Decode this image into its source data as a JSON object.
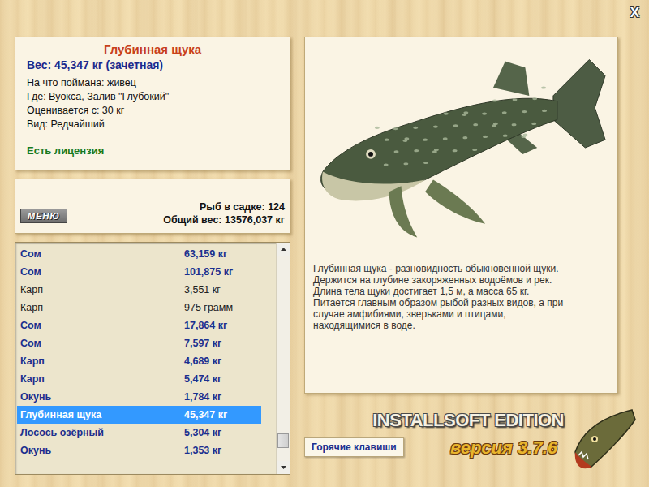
{
  "window": {
    "close": "X"
  },
  "fish_card": {
    "title": "Глубинная щука",
    "weight": "Вес: 45,347 кг (зачетная)",
    "details": [
      "На что поймана: живец",
      "Где: Вуокса, Залив \"Глубокий\"",
      "Оценивается с: 30 кг",
      "Вид: Редчайший"
    ],
    "license": "Есть лицензия"
  },
  "keepnet": {
    "menu_button": "МЕНЮ",
    "count": "Рыб в садке: 124",
    "total_weight": "Общий вес: 13576,037 кг"
  },
  "catch_list": [
    {
      "name": "Сом",
      "weight": "63,159 кг",
      "trophy": true,
      "selected": false
    },
    {
      "name": "Сом",
      "weight": "101,875 кг",
      "trophy": true,
      "selected": false
    },
    {
      "name": "Карп",
      "weight": "3,551 кг",
      "trophy": false,
      "selected": false
    },
    {
      "name": "Карп",
      "weight": "975 грамм",
      "trophy": false,
      "selected": false
    },
    {
      "name": "Сом",
      "weight": "17,864 кг",
      "trophy": true,
      "selected": false
    },
    {
      "name": "Сом",
      "weight": "7,597 кг",
      "trophy": true,
      "selected": false
    },
    {
      "name": "Карп",
      "weight": "4,689 кг",
      "trophy": true,
      "selected": false
    },
    {
      "name": "Карп",
      "weight": "5,474 кг",
      "trophy": true,
      "selected": false
    },
    {
      "name": "Окунь",
      "weight": "1,784 кг",
      "trophy": true,
      "selected": false
    },
    {
      "name": "Глубинная щука",
      "weight": "45,347 кг",
      "trophy": true,
      "selected": true
    },
    {
      "name": "Лосось озёрный",
      "weight": "5,304 кг",
      "trophy": true,
      "selected": false
    },
    {
      "name": "Окунь",
      "weight": "1,353 кг",
      "trophy": true,
      "selected": false
    }
  ],
  "catch_scroll": {
    "position": 0.93
  },
  "description": [
    "Глубинная щука - разновидность обыкновенной щуки.",
    "Держится на глубине закоряженных водоёмов и рек.",
    "Длина тела щуки достигает 1,5 м, а масса 65 кг.",
    "Питается главным образом рыбой разных видов, а при",
    "случае амфибиями, зверьками и птицами,",
    "находящимися в воде."
  ],
  "hotkeys_button": "Горячие клавиши",
  "edition": {
    "name": "INSTALLSOFT EDITION",
    "version": "версия 3.7.6"
  }
}
